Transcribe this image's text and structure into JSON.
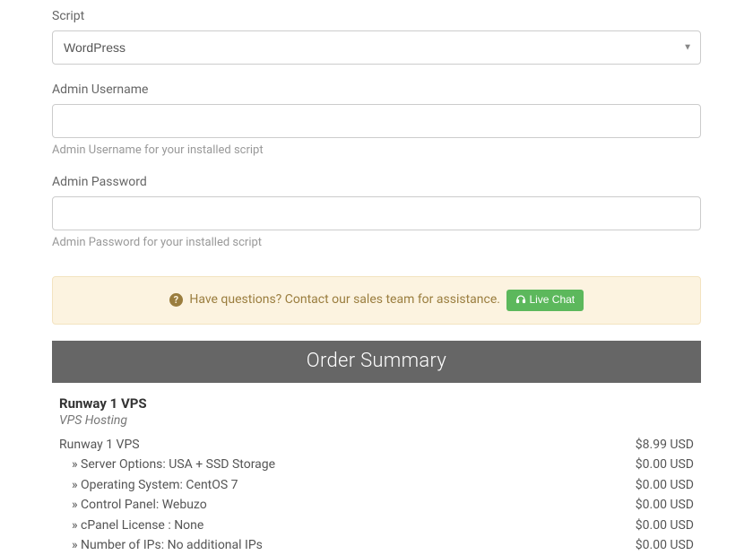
{
  "form": {
    "script": {
      "label": "Script",
      "value": "WordPress"
    },
    "adminUser": {
      "label": "Admin Username",
      "help": "Admin Username for your installed script"
    },
    "adminPass": {
      "label": "Admin Password",
      "help": "Admin Password for your installed script"
    }
  },
  "alert": {
    "text": "Have questions? Contact our sales team for assistance.",
    "button": "Live Chat"
  },
  "summary": {
    "title": "Order Summary",
    "product": "Runway 1 VPS",
    "category": "VPS Hosting",
    "lines": [
      {
        "label": "Runway 1 VPS",
        "price": "$8.99 USD",
        "indent": false
      },
      {
        "label": "Server Options: USA + SSD Storage",
        "price": "$0.00 USD",
        "indent": true
      },
      {
        "label": "Operating System: CentOS 7",
        "price": "$0.00 USD",
        "indent": true
      },
      {
        "label": "Control Panel: Webuzo",
        "price": "$0.00 USD",
        "indent": true
      },
      {
        "label": "cPanel License : None",
        "price": "$0.00 USD",
        "indent": true
      },
      {
        "label": "Number of IPs: No additional IPs",
        "price": "$0.00 USD",
        "indent": true
      }
    ]
  }
}
